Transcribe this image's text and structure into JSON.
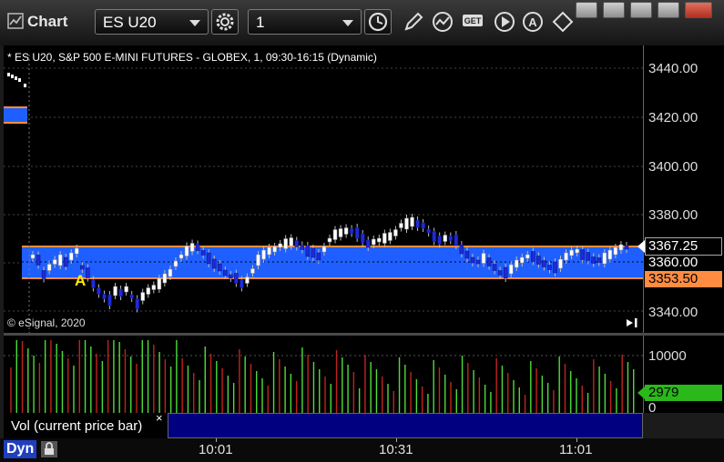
{
  "window": {
    "title": "Chart",
    "symbol": "ES U20",
    "interval": "1"
  },
  "chart_info": "* ES U20, S&P 500 E-MINI FUTURES - GLOBEX, 1, 09:30-16:15 (Dynamic)",
  "copyright": "© eSignal, 2020",
  "marker_label": "A",
  "price_axis": {
    "ticks": [
      "3440.00",
      "3420.00",
      "3400.00",
      "3380.00",
      "3360.00",
      "3340.00"
    ],
    "last_price": "3367.25",
    "mid_price": "3360.00",
    "low_band": "3353.50"
  },
  "volume_axis": {
    "ticks": [
      "10000",
      "0"
    ],
    "current_volume": "2979"
  },
  "volume_label": "Vol (current price bar)",
  "close_mark": "×",
  "time_axis": {
    "ticks": [
      "10:01",
      "10:31",
      "11:01"
    ]
  },
  "status_label": "Dyn",
  "colors": {
    "band": "#1f5fff",
    "band_line": "#ff8c40",
    "up_candle": "#ffffff",
    "down_candle": "#1d2bd6",
    "vol_up": "#4fdc3a",
    "vol_down": "#c0231e",
    "vol_tag": "#2ab81a"
  },
  "icons": [
    "chart-icon",
    "gear-icon",
    "clock-icon",
    "pencil-icon",
    "indicator-icon",
    "get-icon",
    "play-icon",
    "alert-icon",
    "diamond-icon"
  ]
}
